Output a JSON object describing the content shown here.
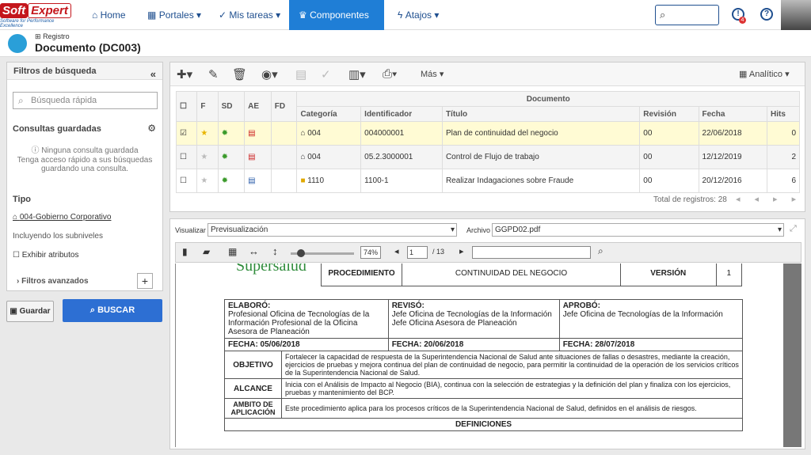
{
  "brand": {
    "l1": "Soft",
    "l2": "Expert",
    "tag": "Software for Performance Excellence"
  },
  "nav": {
    "home": "Home",
    "portals": "Portales",
    "tasks": "Mis tareas",
    "components": "Componentes",
    "shortcuts": "Atajos"
  },
  "notif_count": "4",
  "header": {
    "breadcrumb": "Registro",
    "title": "Documento (DC003)"
  },
  "sidebar": {
    "title": "Filtros de búsqueda",
    "quick_placeholder": "Búsqueda rápida",
    "saved": "Consultas guardadas",
    "none": "Ninguna consulta guardada",
    "hint": "Tenga acceso rápido a sus búsquedas guardando una consulta.",
    "type": "Tipo",
    "type_value": "004-Gobierno Corporativo",
    "sub": "Incluyendo los subniveles",
    "attrs": "Exhibir atributos",
    "advanced": "Filtros avanzados",
    "save": "Guardar",
    "search": "BUSCAR"
  },
  "toolbar": {
    "more": "Más",
    "analytic": "Analítico"
  },
  "grid": {
    "group": "Documento",
    "cols": [
      "F",
      "SD",
      "AE",
      "FD",
      "Categoría",
      "Identificador",
      "Título",
      "Revisión",
      "Fecha",
      "Hits"
    ],
    "rows": [
      {
        "cat": "004",
        "id": "004000001",
        "title": "Plan de continuidad del negocio",
        "rev": "00",
        "date": "22/06/2018",
        "hits": "0"
      },
      {
        "cat": "004",
        "id": "05.2.3000001",
        "title": "Control de Flujo de trabajo",
        "rev": "00",
        "date": "12/12/2019",
        "hits": "2"
      },
      {
        "cat": "1110",
        "id": "1100-1",
        "title": "Realizar Indagaciones sobre Fraude",
        "rev": "00",
        "date": "20/12/2016",
        "hits": "6"
      }
    ],
    "total": "Total de registros: 28"
  },
  "preview": {
    "vis_label": "Visualizar",
    "vis_value": "Previsualización",
    "file_label": "Archivo",
    "file_value": "GGPD02.pdf",
    "zoom": "74%",
    "page": "1",
    "pages": "/ 13"
  },
  "doc": {
    "logo": "Supersalud",
    "proc": "PROCEDIMIENTO",
    "name": "CONTINUIDAD DEL NEGOCIO",
    "ver_l": "VERSIÓN",
    "ver": "1",
    "elab": "ELABORÓ:",
    "elab_t": "Profesional Oficina de Tecnologías de la Información Profesional de la Oficina Asesora de Planeación",
    "rev": "REVISÓ:",
    "rev_t": "Jefe Oficina de Tecnologías de la Información Jefe Oficina Asesora de Planeación",
    "apr": "APROBÓ:",
    "apr_t": "Jefe Oficina de Tecnologías de la Información",
    "f1": "FECHA: 05/06/2018",
    "f2": "FECHA: 20/06/2018",
    "f3": "FECHA: 28/07/2018",
    "obj_l": "OBJETIVO",
    "obj": "Fortalecer la capacidad de respuesta de la Superintendencia Nacional de Salud ante situaciones de fallas o desastres, mediante la creación, ejercicios de pruebas y mejora continua del plan de continuidad de negocio, para permitir la continuidad de la operación de los servicios críticos de la Superintendencia Nacional de Salud.",
    "alc_l": "ALCANCE",
    "alc": "Inicia con el Análisis de Impacto al Negocio (BIA), continua con la selección de estrategias y la definición del plan y finaliza con los ejercicios, pruebas y mantenimiento del BCP.",
    "amb_l": "AMBITO DE APLICACIÓN",
    "amb": "Este procedimiento aplica para los procesos críticos de la Superintendencia Nacional de Salud, definidos en el análisis de riesgos.",
    "defs": "DEFINICIONES"
  }
}
